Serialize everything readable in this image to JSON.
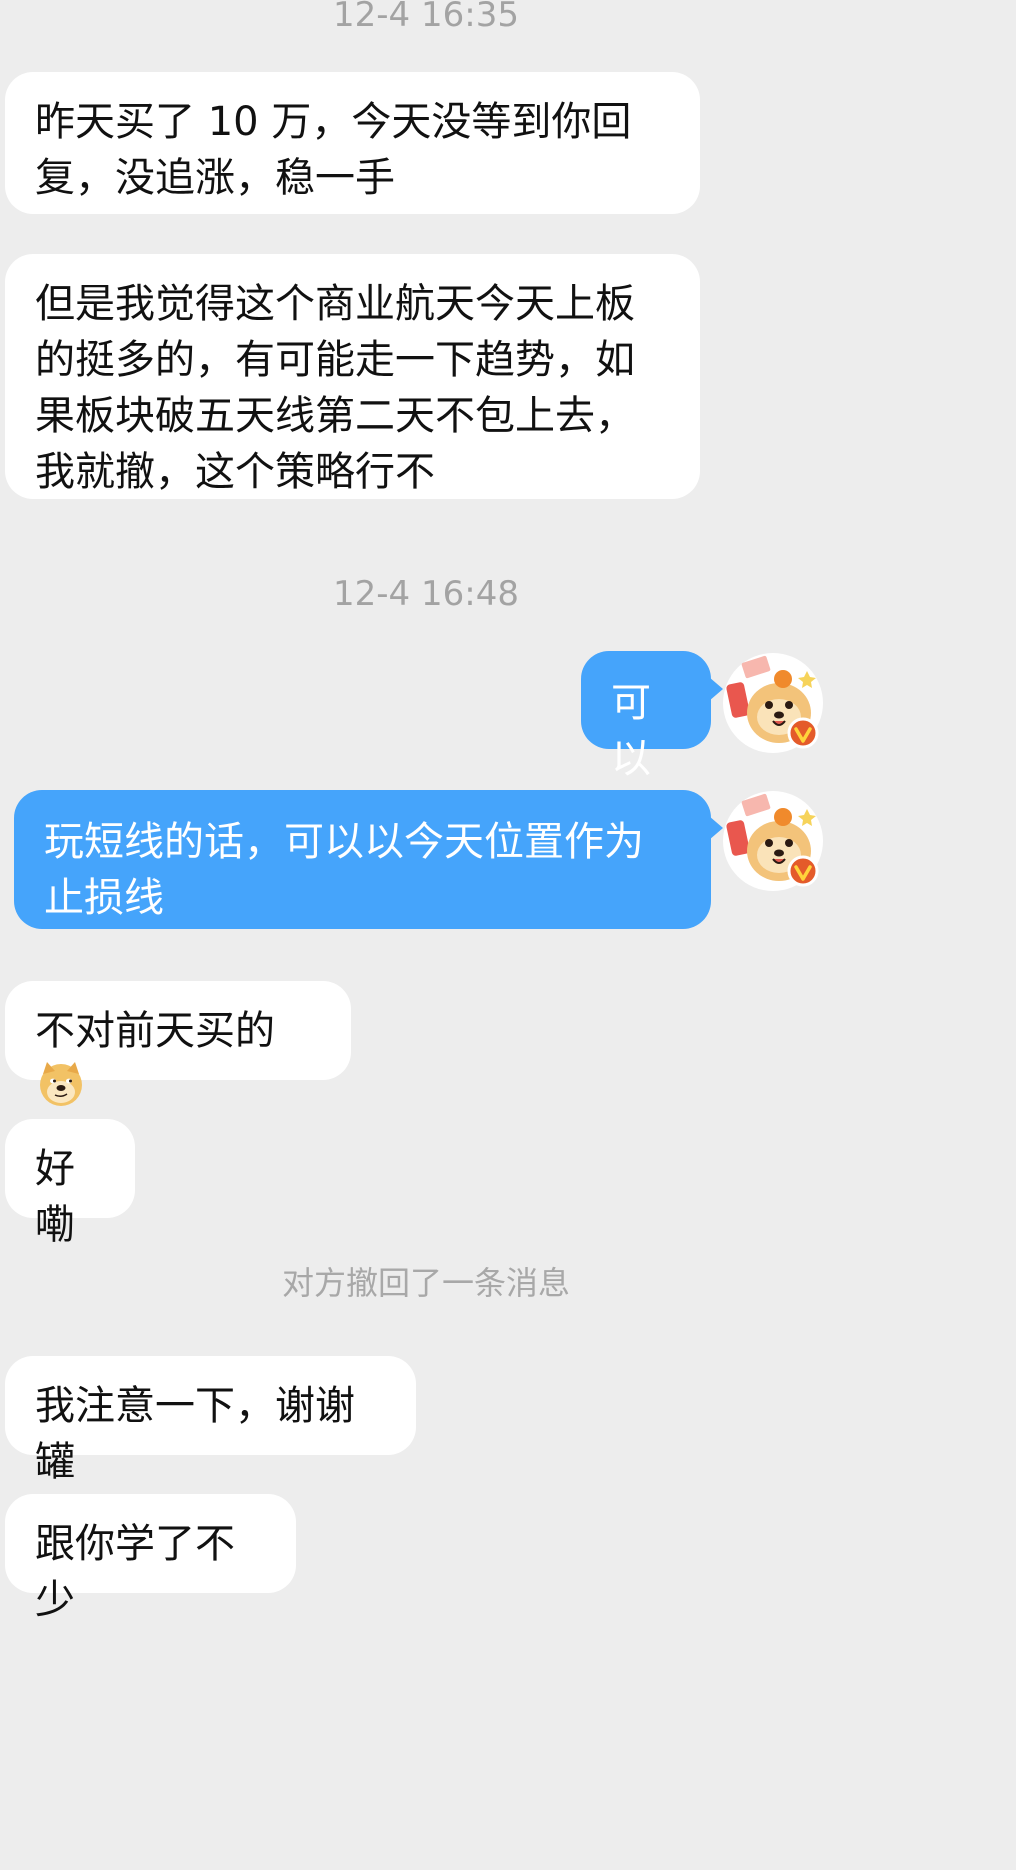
{
  "messages": {
    "ts1": "12-4 16:35",
    "m1": "昨天买了 10 万，今天没等到你回复，没追涨，稳一手",
    "m2": "但是我觉得这个商业航天今天上板的挺多的，有可能走一下趋势，如果板块破五天线第二天不包上去，我就撤，这个策略行不",
    "ts2": "12-4 16:48",
    "m3": "可以",
    "m4": "玩短线的话，可以以今天位置作为止损线",
    "m5": "不对前天买的",
    "m6": "好嘞",
    "system_notice": "对方撤回了一条消息",
    "m7": "我注意一下，谢谢罐",
    "m8": "跟你学了不少"
  },
  "icons": {
    "emoji": "doge-emoji-icon",
    "avatar": "dog-avatar-icon",
    "verified_badge": "verified-v-icon"
  },
  "colors": {
    "background": "#ededed",
    "incoming_bubble": "#ffffff",
    "outgoing_bubble": "#45a4fb",
    "timestamp_text": "#a3a3a3",
    "verified_badge": "#e45b2a"
  }
}
